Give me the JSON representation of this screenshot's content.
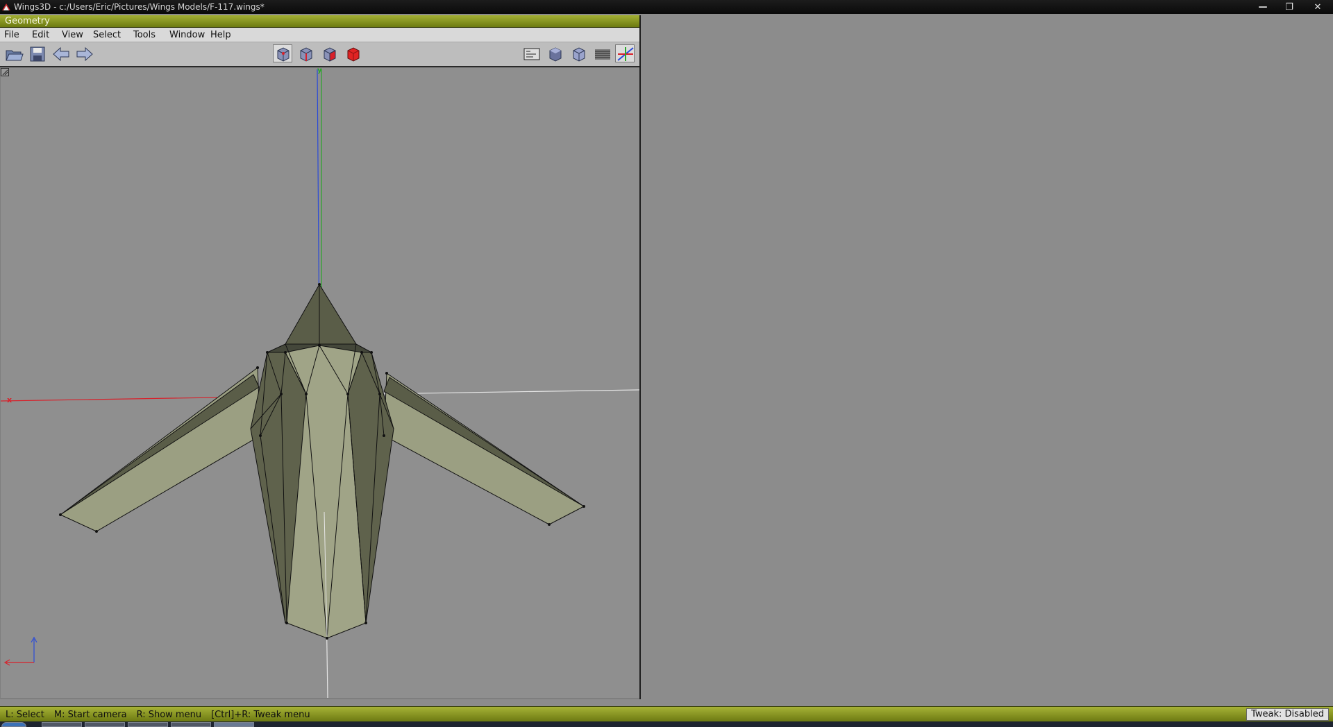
{
  "window": {
    "title": "Wings3D - c:/Users/Eric/Pictures/Wings Models/F-117.wings*",
    "minimize_icon": "minimize-icon",
    "maximize_icon": "restore-icon",
    "close_icon": "close-icon",
    "minimize_label": "—",
    "maximize_label": "❐",
    "close_label": "✕"
  },
  "geometry_window": {
    "title": "Geometry"
  },
  "menu": {
    "file": "File",
    "edit": "Edit",
    "view": "View",
    "select": "Select",
    "tools": "Tools",
    "window": "Window",
    "help": "Help"
  },
  "toolbar": {
    "left_icons": [
      "open-folder-icon",
      "save-icon",
      "undo-arrow-icon",
      "redo-arrow-icon"
    ],
    "select_mode_icons": [
      "vertex-mode-icon",
      "edge-mode-icon",
      "face-mode-icon",
      "body-mode-icon"
    ],
    "right_icons": [
      "frame-camera-icon",
      "smooth-shaded-icon",
      "orthographic-cube-icon",
      "ground-grid-icon",
      "axes-icon"
    ]
  },
  "viewport": {
    "axis_x_label": "x",
    "axis_y_label": "y"
  },
  "status_bar": {
    "hints": [
      "L: Select",
      "M: Start camera",
      "R: Show menu",
      "[Ctrl]+R: Tweak menu"
    ],
    "tweak_status": "Tweak: Disabled"
  },
  "colors": {
    "title_green": "#8c9a22",
    "model_light": "#9b9f82",
    "model_dark": "#5a5d48",
    "axis_x": "#d8202a",
    "axis_y": "#2aa62a",
    "axis_z": "#2a4ad8"
  }
}
